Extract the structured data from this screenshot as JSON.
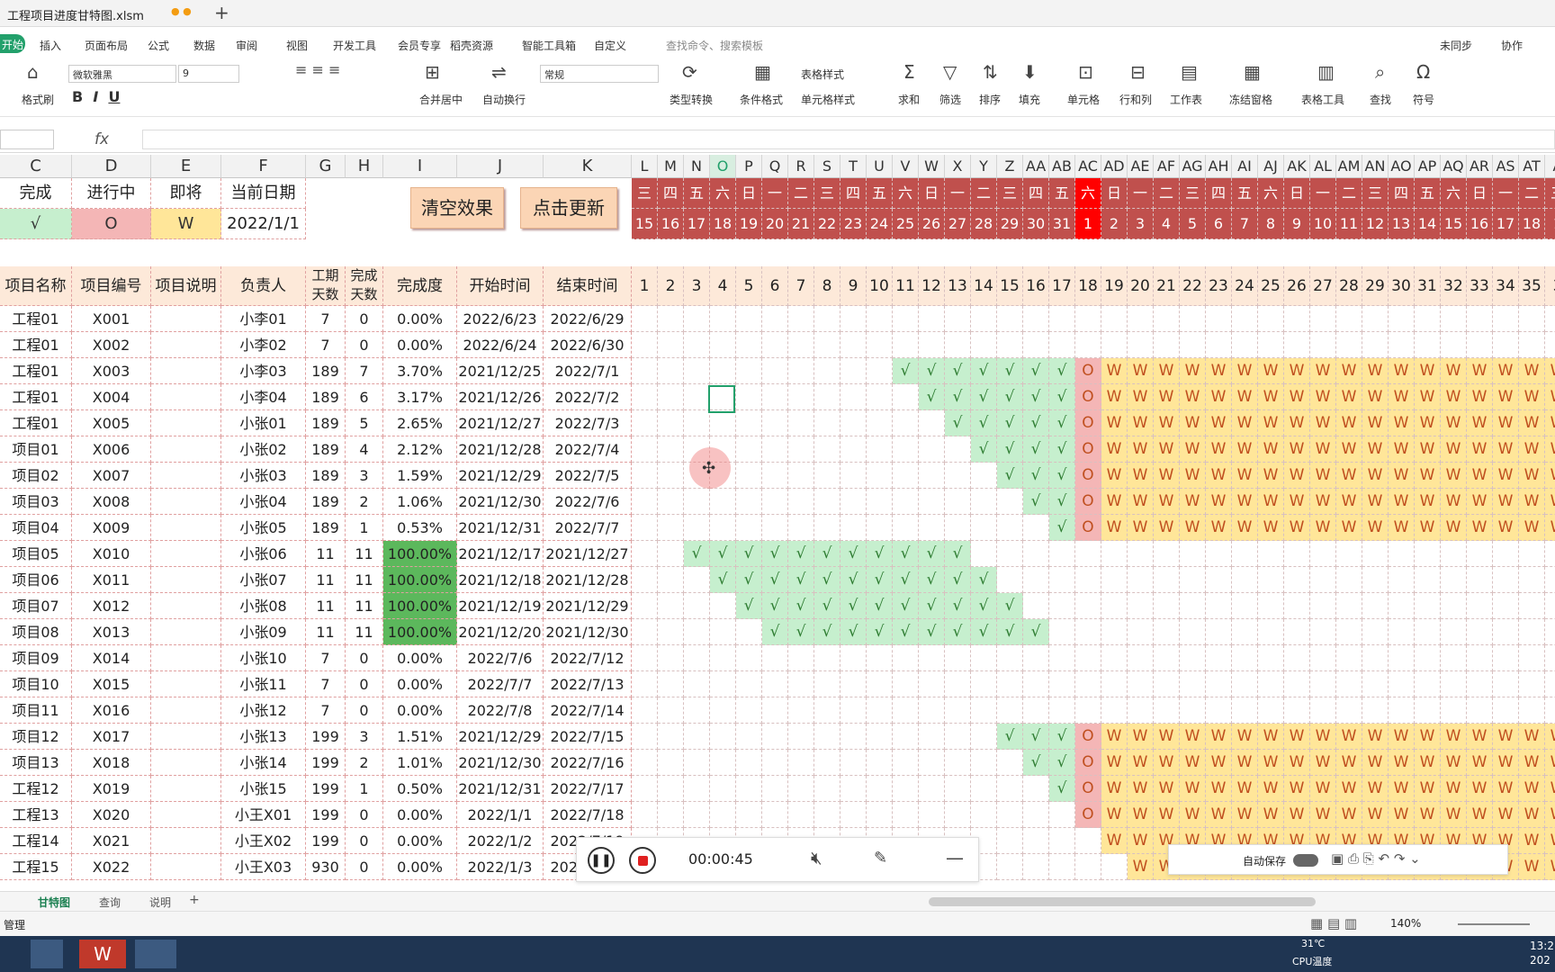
{
  "window": {
    "title": "工程项目进度甘特图.xlsm"
  },
  "menu": {
    "active": "开始",
    "items": [
      "插入",
      "页面布局",
      "公式",
      "数据",
      "审阅",
      "视图",
      "开发工具",
      "会员专享",
      "稻壳资源",
      "智能工具箱",
      "自定义"
    ],
    "search": "查找命令、搜索模板",
    "sync": "未同步",
    "collab": "协作"
  },
  "ribbon": {
    "font": "微软雅黑",
    "size": "9",
    "format": "常规",
    "brush": "格式刷",
    "merge": "合并居中",
    "wrap": "自动换行",
    "convert": "类型转换",
    "cond": "条件格式",
    "tablestyle": "表格样式",
    "cellstyle": "单元格样式",
    "sum": "求和",
    "filter": "筛选",
    "sort": "排序",
    "fill": "填充",
    "cell": "单元格",
    "rowcol": "行和列",
    "sheet": "工作表",
    "freeze": "冻结窗格",
    "tools": "表格工具",
    "find": "查找",
    "symbol": "符号"
  },
  "formula": {
    "fx": "fx"
  },
  "columns": [
    "C",
    "D",
    "E",
    "F",
    "G",
    "H",
    "I",
    "J",
    "K"
  ],
  "gantt_cols": [
    "L",
    "M",
    "N",
    "O",
    "P",
    "Q",
    "R",
    "S",
    "T",
    "U",
    "V",
    "W",
    "X",
    "Y",
    "Z",
    "AA",
    "AB",
    "AC",
    "AD",
    "AE",
    "AF",
    "AG",
    "AH",
    "AI",
    "AJ",
    "AK",
    "AL",
    "AM",
    "AN",
    "AO",
    "AP",
    "AQ",
    "AR",
    "AS",
    "AT",
    "A"
  ],
  "legend": {
    "labels": [
      "完成",
      "进行中",
      "即将",
      "当前日期"
    ],
    "values": [
      "√",
      "O",
      "W",
      "2022/1/1"
    ]
  },
  "buttons": {
    "clear": "清空效果",
    "update": "点击更新"
  },
  "weekdays": [
    "三",
    "四",
    "五",
    "六",
    "日",
    "一",
    "二",
    "三",
    "四",
    "五",
    "六",
    "日",
    "一",
    "二",
    "三",
    "四",
    "五",
    "六",
    "日",
    "一",
    "二",
    "三",
    "四",
    "五",
    "六",
    "日",
    "一",
    "二",
    "三",
    "四",
    "五",
    "六",
    "日",
    "一",
    "二",
    "三"
  ],
  "dates": [
    "15",
    "16",
    "17",
    "18",
    "19",
    "20",
    "21",
    "22",
    "23",
    "24",
    "25",
    "26",
    "27",
    "28",
    "29",
    "30",
    "31",
    "1",
    "2",
    "3",
    "4",
    "5",
    "6",
    "7",
    "8",
    "9",
    "10",
    "11",
    "12",
    "13",
    "14",
    "15",
    "16",
    "17",
    "18",
    "1"
  ],
  "headers": [
    "项目名称",
    "项目编号",
    "项目说明",
    "负责人",
    "工期天数",
    "完成天数",
    "完成度",
    "开始时间",
    "结束时间"
  ],
  "daynums": [
    "1",
    "2",
    "3",
    "4",
    "5",
    "6",
    "7",
    "8",
    "9",
    "10",
    "11",
    "12",
    "13",
    "14",
    "15",
    "16",
    "17",
    "18",
    "19",
    "20",
    "21",
    "22",
    "23",
    "24",
    "25",
    "26",
    "27",
    "28",
    "29",
    "30",
    "31",
    "32",
    "33",
    "34",
    "35",
    "3"
  ],
  "rows": [
    [
      "工程01",
      "X001",
      "",
      "小李01",
      "7",
      "0",
      "0.00%",
      "2022/6/23",
      "2022/6/29"
    ],
    [
      "工程01",
      "X002",
      "",
      "小李02",
      "7",
      "0",
      "0.00%",
      "2022/6/24",
      "2022/6/30"
    ],
    [
      "工程01",
      "X003",
      "",
      "小李03",
      "189",
      "7",
      "3.70%",
      "2021/12/25",
      "2022/7/1"
    ],
    [
      "工程01",
      "X004",
      "",
      "小李04",
      "189",
      "6",
      "3.17%",
      "2021/12/26",
      "2022/7/2"
    ],
    [
      "工程01",
      "X005",
      "",
      "小张01",
      "189",
      "5",
      "2.65%",
      "2021/12/27",
      "2022/7/3"
    ],
    [
      "项目01",
      "X006",
      "",
      "小张02",
      "189",
      "4",
      "2.12%",
      "2021/12/28",
      "2022/7/4"
    ],
    [
      "项目02",
      "X007",
      "",
      "小张03",
      "189",
      "3",
      "1.59%",
      "2021/12/29",
      "2022/7/5"
    ],
    [
      "项目03",
      "X008",
      "",
      "小张04",
      "189",
      "2",
      "1.06%",
      "2021/12/30",
      "2022/7/6"
    ],
    [
      "项目04",
      "X009",
      "",
      "小张05",
      "189",
      "1",
      "0.53%",
      "2021/12/31",
      "2022/7/7"
    ],
    [
      "项目05",
      "X010",
      "",
      "小张06",
      "11",
      "11",
      "100.00%",
      "2021/12/17",
      "2021/12/27"
    ],
    [
      "项目06",
      "X011",
      "",
      "小张07",
      "11",
      "11",
      "100.00%",
      "2021/12/18",
      "2021/12/28"
    ],
    [
      "项目07",
      "X012",
      "",
      "小张08",
      "11",
      "11",
      "100.00%",
      "2021/12/19",
      "2021/12/29"
    ],
    [
      "项目08",
      "X013",
      "",
      "小张09",
      "11",
      "11",
      "100.00%",
      "2021/12/20",
      "2021/12/30"
    ],
    [
      "项目09",
      "X014",
      "",
      "小张10",
      "7",
      "0",
      "0.00%",
      "2022/7/6",
      "2022/7/12"
    ],
    [
      "项目10",
      "X015",
      "",
      "小张11",
      "7",
      "0",
      "0.00%",
      "2022/7/7",
      "2022/7/13"
    ],
    [
      "项目11",
      "X016",
      "",
      "小张12",
      "7",
      "0",
      "0.00%",
      "2022/7/8",
      "2022/7/14"
    ],
    [
      "项目12",
      "X017",
      "",
      "小张13",
      "199",
      "3",
      "1.51%",
      "2021/12/29",
      "2022/7/15"
    ],
    [
      "项目13",
      "X018",
      "",
      "小张14",
      "199",
      "2",
      "1.01%",
      "2021/12/30",
      "2022/7/16"
    ],
    [
      "工程12",
      "X019",
      "",
      "小张15",
      "199",
      "1",
      "0.50%",
      "2021/12/31",
      "2022/7/17"
    ],
    [
      "工程13",
      "X020",
      "",
      "小王X01",
      "199",
      "0",
      "0.00%",
      "2022/1/1",
      "2022/7/18"
    ],
    [
      "工程14",
      "X021",
      "",
      "小王X02",
      "199",
      "0",
      "0.00%",
      "2022/1/2",
      "2022/7/19"
    ],
    [
      "工程15",
      "X022",
      "",
      "小王X03",
      "930",
      "0",
      "0.00%",
      "2022/1/3",
      "2022/7/20"
    ]
  ],
  "gantt": [
    {
      "start": 0,
      "done": 0,
      "prog": false,
      "wait": 0
    },
    {
      "start": 0,
      "done": 0,
      "prog": false,
      "wait": 0
    },
    {
      "start": 10,
      "done": 7,
      "prog": true,
      "wait": 18
    },
    {
      "start": 11,
      "done": 6,
      "prog": true,
      "wait": 18
    },
    {
      "start": 12,
      "done": 5,
      "prog": true,
      "wait": 18
    },
    {
      "start": 13,
      "done": 4,
      "prog": true,
      "wait": 18
    },
    {
      "start": 14,
      "done": 3,
      "prog": true,
      "wait": 18
    },
    {
      "start": 15,
      "done": 2,
      "prog": true,
      "wait": 18
    },
    {
      "start": 16,
      "done": 1,
      "prog": true,
      "wait": 18
    },
    {
      "start": 2,
      "done": 11,
      "prog": false,
      "wait": 0
    },
    {
      "start": 3,
      "done": 11,
      "prog": false,
      "wait": 0
    },
    {
      "start": 4,
      "done": 11,
      "prog": false,
      "wait": 0
    },
    {
      "start": 5,
      "done": 11,
      "prog": false,
      "wait": 0
    },
    {
      "start": 0,
      "done": 0,
      "prog": false,
      "wait": 0
    },
    {
      "start": 0,
      "done": 0,
      "prog": false,
      "wait": 0
    },
    {
      "start": 0,
      "done": 0,
      "prog": false,
      "wait": 0
    },
    {
      "start": 14,
      "done": 3,
      "prog": true,
      "wait": 18
    },
    {
      "start": 15,
      "done": 2,
      "prog": true,
      "wait": 18
    },
    {
      "start": 16,
      "done": 1,
      "prog": true,
      "wait": 18
    },
    {
      "start": 17,
      "done": 0,
      "prog": true,
      "wait": 18
    },
    {
      "start": 18,
      "done": 0,
      "prog": false,
      "wait": 18
    },
    {
      "start": 19,
      "done": 0,
      "prog": false,
      "wait": 19
    }
  ],
  "tabs": [
    "甘特图",
    "查询",
    "说明"
  ],
  "status": {
    "left": "管理",
    "zoom": "140%"
  },
  "recorder": {
    "time": "00:00:45"
  },
  "autosave": {
    "label": "自动保存"
  },
  "taskbar": {
    "temp": "31℃",
    "cpu": "CPU温度",
    "clock": "13:2",
    "year": "202"
  },
  "colors": {
    "done": "#c6efce",
    "prog": "#f4b6b6",
    "wait": "#ffe699",
    "red": "#c0504d",
    "today": "#ff0000",
    "full": "#5cb85c"
  }
}
